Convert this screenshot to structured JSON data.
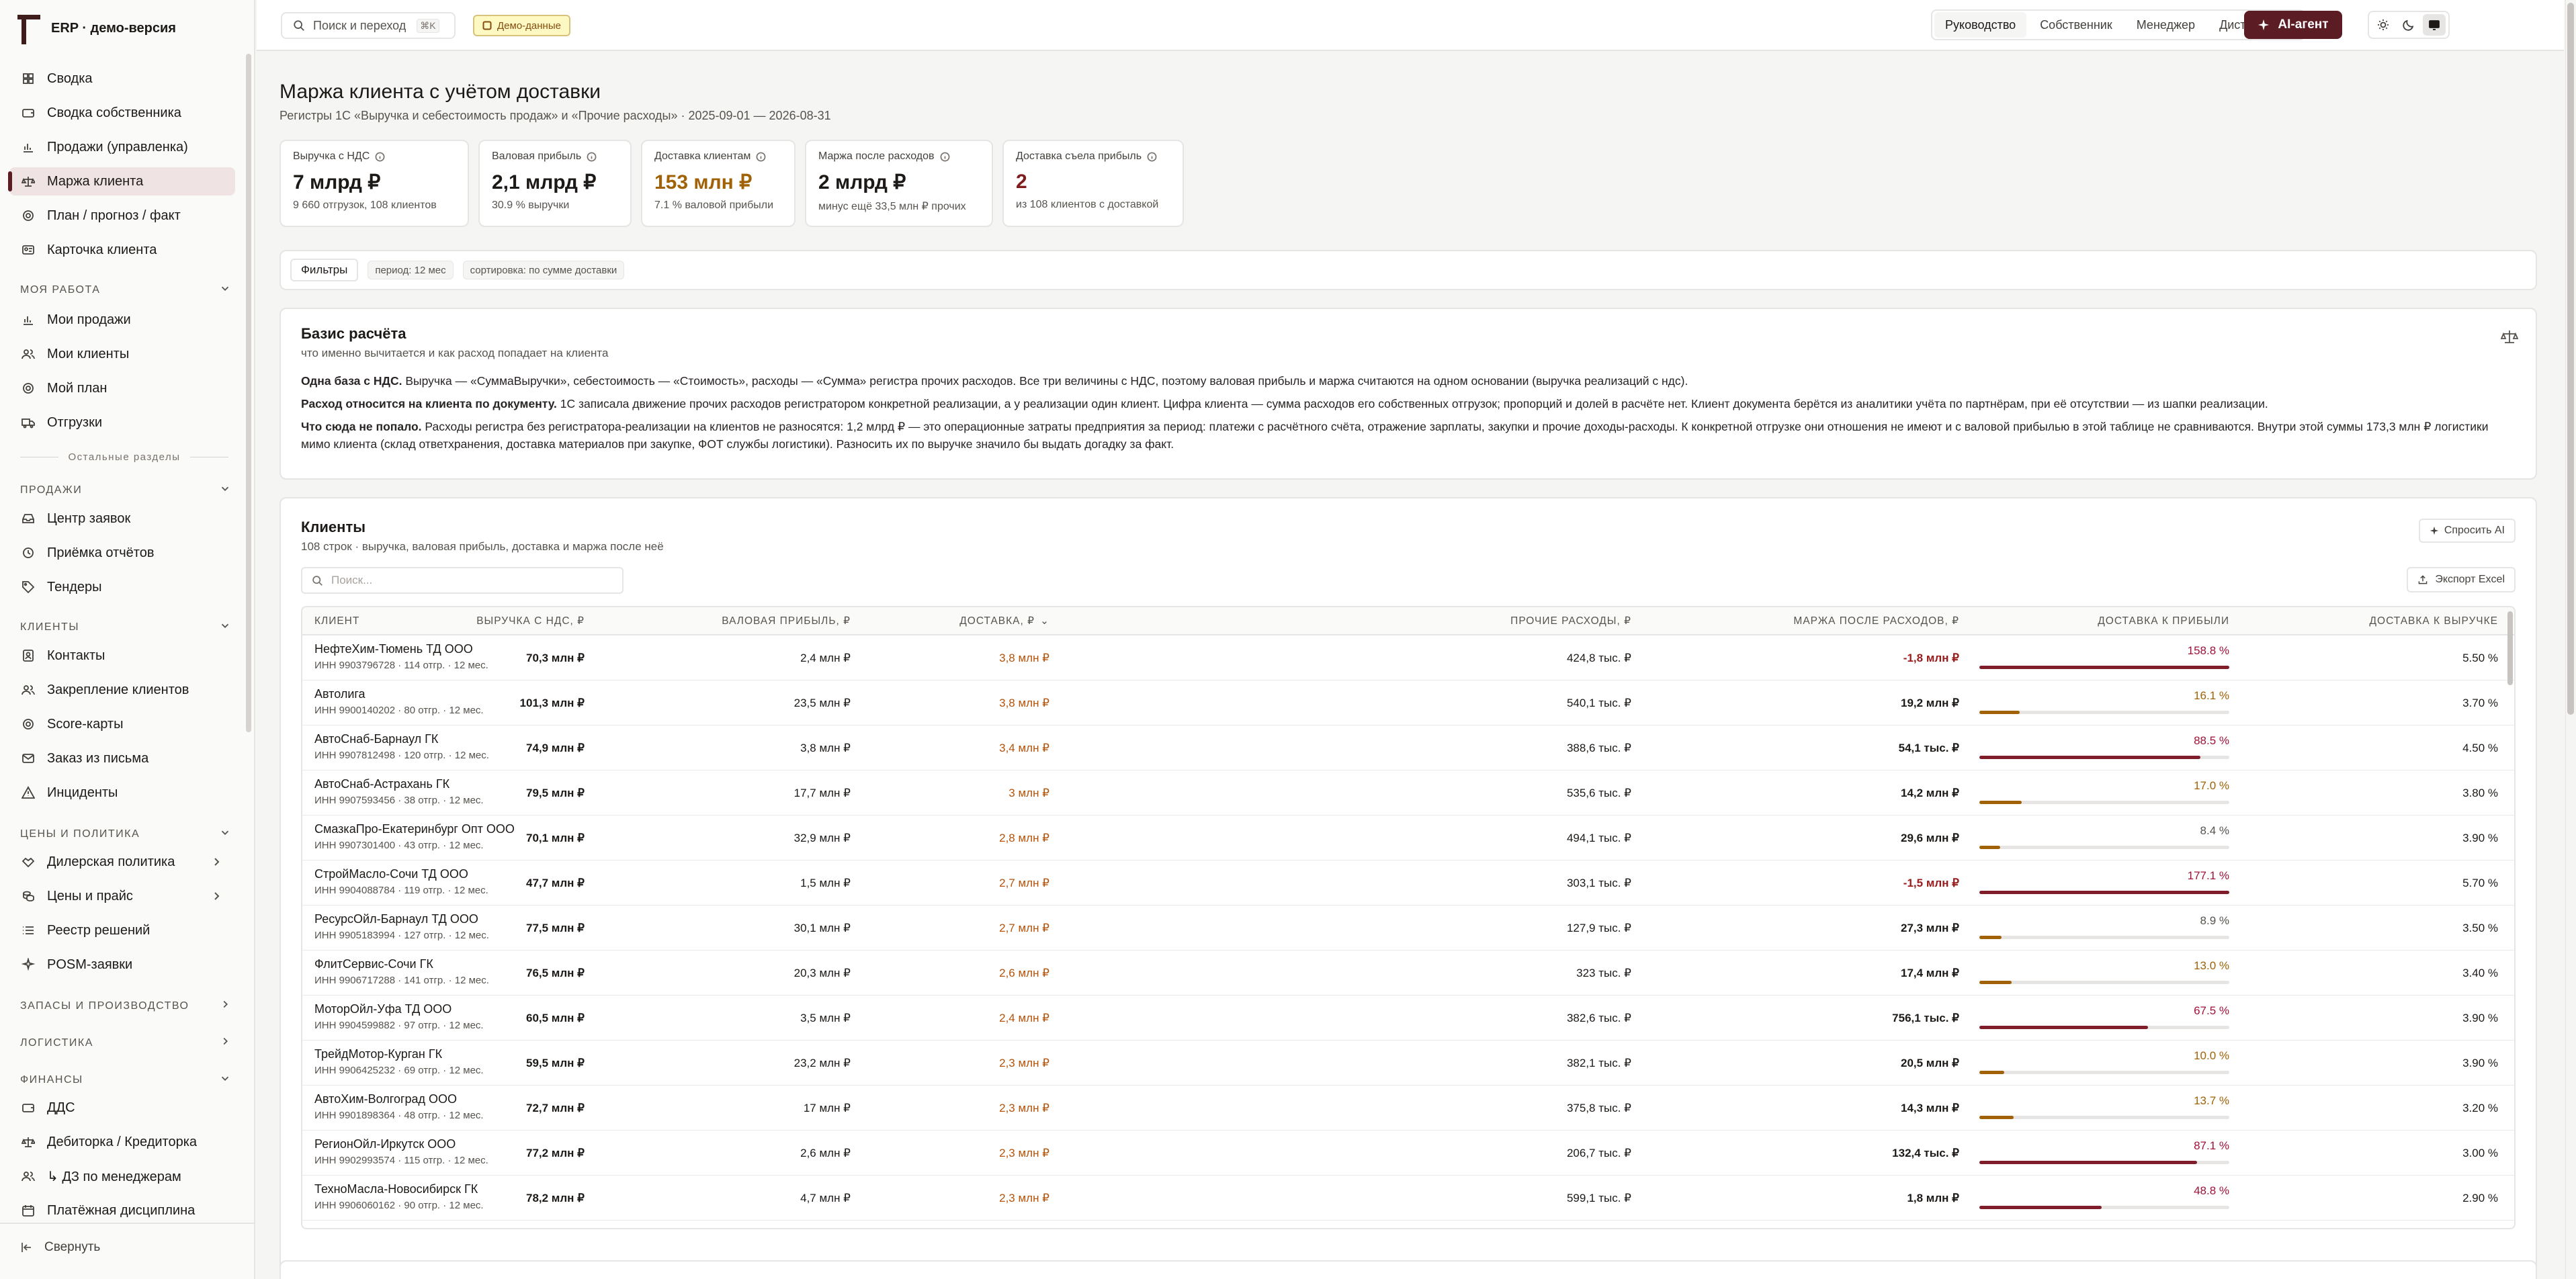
{
  "app": {
    "title": "ERP · демо-версия"
  },
  "sidebar": {
    "main_items": [
      {
        "label": "Сводка",
        "icon": "grid-icon"
      },
      {
        "label": "Сводка собственника",
        "icon": "wallet-icon"
      },
      {
        "label": "Продажи (управленка)",
        "icon": "bar-chart-icon"
      },
      {
        "label": "Маржа клиента",
        "icon": "scale-icon"
      },
      {
        "label": "План / прогноз / факт",
        "icon": "target-icon"
      },
      {
        "label": "Карточка клиента",
        "icon": "user-card-icon"
      }
    ],
    "my_work": {
      "title": "Моя работа",
      "items": [
        {
          "label": "Мои продажи",
          "icon": "bar-chart-icon"
        },
        {
          "label": "Мои клиенты",
          "icon": "users-icon"
        },
        {
          "label": "Мой план",
          "icon": "target-icon"
        },
        {
          "label": "Отгрузки",
          "icon": "truck-icon"
        }
      ]
    },
    "other_sections": "Остальные разделы",
    "sales": {
      "title": "Продажи",
      "items": [
        {
          "label": "Центр заявок",
          "icon": "inbox-icon"
        },
        {
          "label": "Приёмка отчётов",
          "icon": "clock-icon"
        },
        {
          "label": "Тендеры",
          "icon": "tag-icon"
        }
      ]
    },
    "clients": {
      "title": "Клиенты",
      "items": [
        {
          "label": "Контакты",
          "icon": "contacts-icon"
        },
        {
          "label": "Закрепление клиентов",
          "icon": "users-icon"
        },
        {
          "label": "Score-карты",
          "icon": "target-icon"
        },
        {
          "label": "Заказ из письма",
          "icon": "mail-icon"
        },
        {
          "label": "Инциденты",
          "icon": "alert-icon"
        }
      ]
    },
    "pricing": {
      "title": "Цены и политика",
      "items": [
        {
          "label": "Дилерская политика",
          "icon": "handshake-icon"
        },
        {
          "label": "Цены и прайс",
          "icon": "coins-icon"
        },
        {
          "label": "Реестр решений",
          "icon": "list-icon"
        },
        {
          "label": "POSM-заявки",
          "icon": "sparkle-icon"
        }
      ]
    },
    "stock": {
      "title": "Запасы и производство"
    },
    "logistics": {
      "title": "Логистика"
    },
    "finance": {
      "title": "Финансы",
      "items": [
        {
          "label": "ДДС",
          "icon": "wallet-icon"
        },
        {
          "label": "Дебиторка / Кредиторка",
          "icon": "scale-icon"
        },
        {
          "label": "↳ ДЗ по менеджерам",
          "icon": "users-icon"
        },
        {
          "label": "Платёжная дисциплина",
          "icon": "calendar-icon"
        }
      ]
    },
    "collapse_label": "Свернуть"
  },
  "topbar": {
    "search_placeholder": "Поиск и переход",
    "search_shortcut": "⌘K",
    "demo_badge": "Демо-данные",
    "roles": [
      "Руководство",
      "Собственник",
      "Менеджер",
      "Дистрибутор"
    ],
    "active_role": "Руководство",
    "ai_button": "AI-агент"
  },
  "page": {
    "title": "Маржа клиента с учётом доставки",
    "subtitle": "Регистры 1С «Выручка и себестоимость продаж» и «Прочие расходы» · 2025-09-01 — 2026-08-31"
  },
  "kpis": [
    {
      "label": "Выручка с НДС",
      "value": "7 млрд ₽",
      "note": "9 660 отгрузок, 108 клиентов",
      "tone": ""
    },
    {
      "label": "Валовая прибыль",
      "value": "2,1 млрд ₽",
      "note": "30.9 % выручки",
      "tone": ""
    },
    {
      "label": "Доставка клиентам",
      "value": "153 млн ₽",
      "note": "7.1 % валовой прибыли",
      "tone": "gold"
    },
    {
      "label": "Маржа после расходов",
      "value": "2 млрд ₽",
      "note": "минус ещё 33,5 млн ₽ прочих",
      "tone": ""
    },
    {
      "label": "Доставка съела прибыль",
      "value": "2",
      "note": "из 108 клиентов с доставкой",
      "tone": "red"
    }
  ],
  "filters": {
    "button": "Фильтры",
    "chips": [
      "период: 12 мес",
      "сортировка: по сумме доставки"
    ]
  },
  "basis": {
    "title": "Базис расчёта",
    "subtitle": "что именно вычитается и как расход попадает на клиента",
    "p1_bold": "Одна база с НДС.",
    "p1_text": " Выручка — «СуммаВыручки», себестоимость — «Стоимость», расходы — «Сумма» регистра прочих расходов. Все три величины с НДС, поэтому валовая прибыль и маржа считаются на одном основании (выручка реализаций с ндс).",
    "p2_bold": "Расход относится на клиента по документу.",
    "p2_text": " 1С записала движение прочих расходов регистратором конкретной реализации, а у реализации один клиент. Цифра клиента — сумма расходов его собственных отгрузок; пропорций и долей в расчёте нет. Клиент документа берётся из аналитики учёта по партнёрам, при её отсутствии — из шапки реализации.",
    "p3_bold": "Что сюда не попало.",
    "p3_text": " Расходы регистра без регистратора-реализации на клиентов не разносятся: 1,2 млрд ₽ — это операционные затраты предприятия за период: платежи с расчётного счёта, отражение зарплаты, закупки и прочие доходы-расходы. К конкретной отгрузке они отношения не имеют и с валовой прибылью в этой таблице не сравниваются. Внутри этой суммы 173,3 млн ₽ логистики мимо клиента (склад ответхранения, доставка материалов при закупке, ФОТ службы логистики). Разносить их по выручке значило бы выдать догадку за факт."
  },
  "clients": {
    "title": "Клиенты",
    "subtitle": "108 строк · выручка, валовая прибыль, доставка и маржа после неё",
    "ask_ai": "Спросить AI",
    "search_placeholder": "Поиск...",
    "export": "Экспорт Excel",
    "columns": [
      "Клиент",
      "Выручка с НДС, ₽",
      "Валовая прибыль, ₽",
      "Доставка, ₽",
      "Прочие расходы, ₽",
      "Маржа после расходов, ₽",
      "Доставка к прибыли",
      "Доставка к выручке"
    ],
    "rows": [
      {
        "name": "НефтеХим-Тюмень ТД ООО",
        "info": "ИНН 9903796728 · 114 отгр. · 12 мес.",
        "revenue": "70,3 млн ₽",
        "gross": "2,4 млн ₽",
        "delivery": "3,8 млн ₽",
        "other": "424,8 тыс. ₽",
        "margin": "-1,8 млн ₽",
        "margin_neg": true,
        "d2p": "158.8 %",
        "d2p_value": 158.8,
        "tone": "red",
        "d2r": "5.50 %"
      },
      {
        "name": "Автолига",
        "info": "ИНН 9900140202 · 80 отгр. · 12 мес.",
        "revenue": "101,3 млн ₽",
        "gross": "23,5 млн ₽",
        "delivery": "3,8 млн ₽",
        "other": "540,1 тыс. ₽",
        "margin": "19,2 млн ₽",
        "margin_neg": false,
        "d2p": "16.1 %",
        "d2p_value": 16.1,
        "tone": "gold",
        "d2r": "3.70 %"
      },
      {
        "name": "АвтоСнаб-Барнаул ГК",
        "info": "ИНН 9907812498 · 120 отгр. · 12 мес.",
        "revenue": "74,9 млн ₽",
        "gross": "3,8 млн ₽",
        "delivery": "3,4 млн ₽",
        "other": "388,6 тыс. ₽",
        "margin": "54,1 тыс. ₽",
        "margin_neg": false,
        "d2p": "88.5 %",
        "d2p_value": 88.5,
        "tone": "red",
        "d2r": "4.50 %"
      },
      {
        "name": "АвтоСнаб-Астрахань ГК",
        "info": "ИНН 9907593456 · 38 отгр. · 12 мес.",
        "revenue": "79,5 млн ₽",
        "gross": "17,7 млн ₽",
        "delivery": "3 млн ₽",
        "other": "535,6 тыс. ₽",
        "margin": "14,2 млн ₽",
        "margin_neg": false,
        "d2p": "17.0 %",
        "d2p_value": 17.0,
        "tone": "gold",
        "d2r": "3.80 %"
      },
      {
        "name": "СмазкаПро-Екатеринбург Опт ООО",
        "info": "ИНН 9907301400 · 43 отгр. · 12 мес.",
        "revenue": "70,1 млн ₽",
        "gross": "32,9 млн ₽",
        "delivery": "2,8 млн ₽",
        "other": "494,1 тыс. ₽",
        "margin": "29,6 млн ₽",
        "margin_neg": false,
        "d2p": "8.4 %",
        "d2p_value": 8.4,
        "tone": "gray",
        "d2r": "3.90 %"
      },
      {
        "name": "СтройМасло-Сочи ТД ООО",
        "info": "ИНН 9904088784 · 119 отгр. · 12 мес.",
        "revenue": "47,7 млн ₽",
        "gross": "1,5 млн ₽",
        "delivery": "2,7 млн ₽",
        "other": "303,1 тыс. ₽",
        "margin": "-1,5 млн ₽",
        "margin_neg": true,
        "d2p": "177.1 %",
        "d2p_value": 177.1,
        "tone": "red",
        "d2r": "5.70 %"
      },
      {
        "name": "РесурсОйл-Барнаул ТД ООО",
        "info": "ИНН 9905183994 · 127 отгр. · 12 мес.",
        "revenue": "77,5 млн ₽",
        "gross": "30,1 млн ₽",
        "delivery": "2,7 млн ₽",
        "other": "127,9 тыс. ₽",
        "margin": "27,3 млн ₽",
        "margin_neg": false,
        "d2p": "8.9 %",
        "d2p_value": 8.9,
        "tone": "gray",
        "d2r": "3.50 %"
      },
      {
        "name": "ФлитСервис-Сочи ГК",
        "info": "ИНН 9906717288 · 141 отгр. · 12 мес.",
        "revenue": "76,5 млн ₽",
        "gross": "20,3 млн ₽",
        "delivery": "2,6 млн ₽",
        "other": "323 тыс. ₽",
        "margin": "17,4 млн ₽",
        "margin_neg": false,
        "d2p": "13.0 %",
        "d2p_value": 13.0,
        "tone": "gold",
        "d2r": "3.40 %"
      },
      {
        "name": "МоторОйл-Уфа ТД ООО",
        "info": "ИНН 9904599882 · 97 отгр. · 12 мес.",
        "revenue": "60,5 млн ₽",
        "gross": "3,5 млн ₽",
        "delivery": "2,4 млн ₽",
        "other": "382,6 тыс. ₽",
        "margin": "756,1 тыс. ₽",
        "margin_neg": false,
        "d2p": "67.5 %",
        "d2p_value": 67.5,
        "tone": "red",
        "d2r": "3.90 %"
      },
      {
        "name": "ТрейдМотор-Курган ГК",
        "info": "ИНН 9906425232 · 69 отгр. · 12 мес.",
        "revenue": "59,5 млн ₽",
        "gross": "23,2 млн ₽",
        "delivery": "2,3 млн ₽",
        "other": "382,1 тыс. ₽",
        "margin": "20,5 млн ₽",
        "margin_neg": false,
        "d2p": "10.0 %",
        "d2p_value": 10.0,
        "tone": "gold",
        "d2r": "3.90 %"
      },
      {
        "name": "АвтоХим-Волгоград ООО",
        "info": "ИНН 9901898364 · 48 отгр. · 12 мес.",
        "revenue": "72,7 млн ₽",
        "gross": "17 млн ₽",
        "delivery": "2,3 млн ₽",
        "other": "375,8 тыс. ₽",
        "margin": "14,3 млн ₽",
        "margin_neg": false,
        "d2p": "13.7 %",
        "d2p_value": 13.7,
        "tone": "gold",
        "d2r": "3.20 %"
      },
      {
        "name": "РегионОйл-Иркутск ООО",
        "info": "ИНН 9902993574 · 115 отгр. · 12 мес.",
        "revenue": "77,2 млн ₽",
        "gross": "2,6 млн ₽",
        "delivery": "2,3 млн ₽",
        "other": "206,7 тыс. ₽",
        "margin": "132,4 тыс. ₽",
        "margin_neg": false,
        "d2p": "87.1 %",
        "d2p_value": 87.1,
        "tone": "red",
        "d2r": "3.00 %"
      },
      {
        "name": "ТехноМасла-Новосибирск ГК",
        "info": "ИНН 9906060162 · 90 отгр. · 12 мес.",
        "revenue": "78,2 млн ₽",
        "gross": "4,7 млн ₽",
        "delivery": "2,3 млн ₽",
        "other": "599,1 тыс. ₽",
        "margin": "1,8 млн ₽",
        "margin_neg": false,
        "d2p": "48.8 %",
        "d2p_value": 48.8,
        "tone": "red",
        "d2r": "2.90 %"
      }
    ]
  },
  "colors": {
    "accent": "#5b1c24",
    "bar_red": "#7f1d2b",
    "bar_gold": "#a16207",
    "delivery_text": "#b45309"
  }
}
